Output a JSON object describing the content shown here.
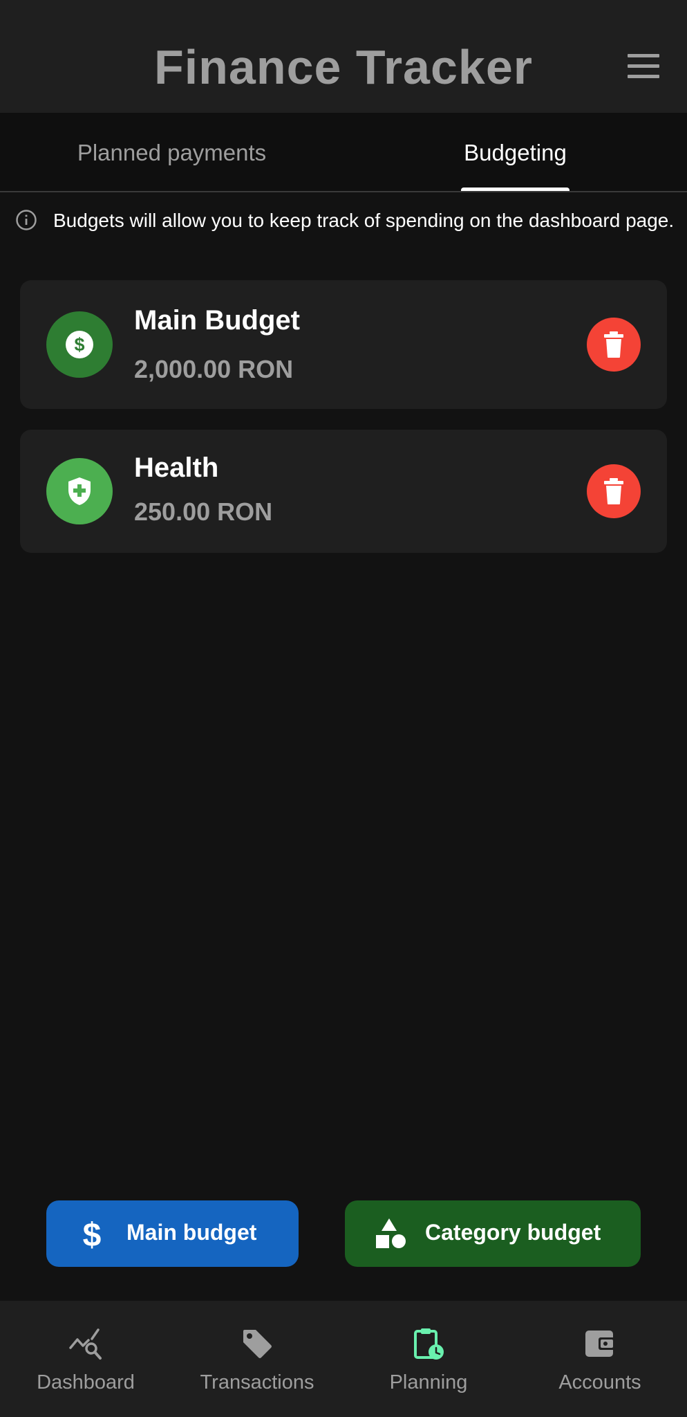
{
  "app_bar": {
    "title": "Finance Tracker",
    "menu_icon": "menu-icon"
  },
  "tabs": [
    {
      "label": "Planned payments",
      "selected": false
    },
    {
      "label": "Budgeting",
      "selected": true
    }
  ],
  "info": {
    "icon": "info-icon",
    "text": "Budgets will allow you to keep track of spending on the dashboard page."
  },
  "budgets": [
    {
      "name": "Main Budget",
      "amount": "2,000.00 RON",
      "icon": "dollar-circle-icon",
      "color": "#2e7d32"
    },
    {
      "name": "Health",
      "amount": "250.00 RON",
      "icon": "health-shield-icon",
      "color": "#4caf50"
    }
  ],
  "actions": {
    "main_budget": {
      "label": "Main budget",
      "icon": "dollar-icon",
      "color": "#1565c0"
    },
    "category_budget": {
      "label": "Category budget",
      "icon": "category-shapes-icon",
      "color": "#1b5e20"
    }
  },
  "bottom_nav": [
    {
      "label": "Dashboard",
      "icon": "chart-search-icon",
      "active": false
    },
    {
      "label": "Transactions",
      "icon": "tag-icon",
      "active": false
    },
    {
      "label": "Planning",
      "icon": "clipboard-clock-icon",
      "active": true
    },
    {
      "label": "Accounts",
      "icon": "wallet-icon",
      "active": false
    }
  ],
  "colors": {
    "background": "#121212",
    "surface": "#1f1f1f",
    "delete": "#f44336",
    "planning_active": "#69f0ae"
  }
}
